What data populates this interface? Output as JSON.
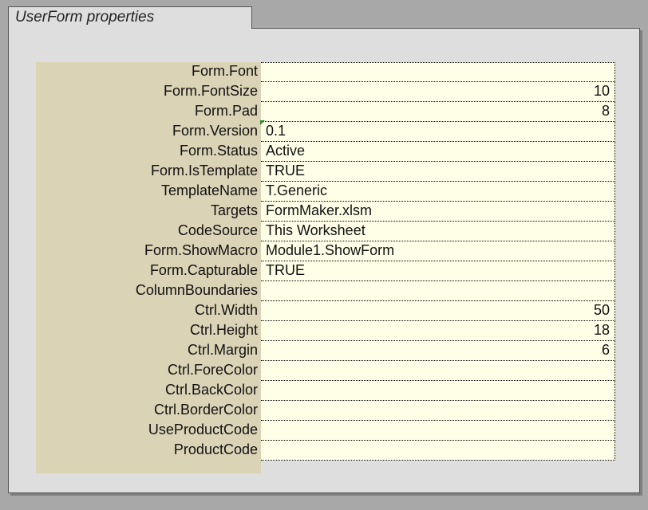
{
  "title": "UserForm properties",
  "rows": [
    {
      "label": "Form.Font",
      "value": "",
      "align": "left",
      "tick": false
    },
    {
      "label": "Form.FontSize",
      "value": "10",
      "align": "right",
      "tick": false
    },
    {
      "label": "Form.Pad",
      "value": "8",
      "align": "right",
      "tick": false
    },
    {
      "label": "Form.Version",
      "value": "0.1",
      "align": "left",
      "tick": true
    },
    {
      "label": "Form.Status",
      "value": "Active",
      "align": "left",
      "tick": false
    },
    {
      "label": "Form.IsTemplate",
      "value": "TRUE",
      "align": "left",
      "tick": false
    },
    {
      "label": "TemplateName",
      "value": "T.Generic",
      "align": "left",
      "tick": false
    },
    {
      "label": "Targets",
      "value": "FormMaker.xlsm",
      "align": "left",
      "tick": false
    },
    {
      "label": "CodeSource",
      "value": "This Worksheet",
      "align": "left",
      "tick": false
    },
    {
      "label": "Form.ShowMacro",
      "value": "Module1.ShowForm",
      "align": "left",
      "tick": false
    },
    {
      "label": "Form.Capturable",
      "value": "TRUE",
      "align": "left",
      "tick": false
    },
    {
      "label": "ColumnBoundaries",
      "value": "",
      "align": "left",
      "tick": false
    },
    {
      "label": "Ctrl.Width",
      "value": "50",
      "align": "right",
      "tick": false
    },
    {
      "label": "Ctrl.Height",
      "value": "18",
      "align": "right",
      "tick": false
    },
    {
      "label": "Ctrl.Margin",
      "value": "6",
      "align": "right",
      "tick": false
    },
    {
      "label": "Ctrl.ForeColor",
      "value": "",
      "align": "left",
      "tick": false
    },
    {
      "label": "Ctrl.BackColor",
      "value": "",
      "align": "left",
      "tick": false
    },
    {
      "label": "Ctrl.BorderColor",
      "value": "",
      "align": "left",
      "tick": false
    },
    {
      "label": "UseProductCode",
      "value": "",
      "align": "left",
      "tick": false
    },
    {
      "label": "ProductCode",
      "value": "",
      "align": "left",
      "tick": false
    }
  ]
}
